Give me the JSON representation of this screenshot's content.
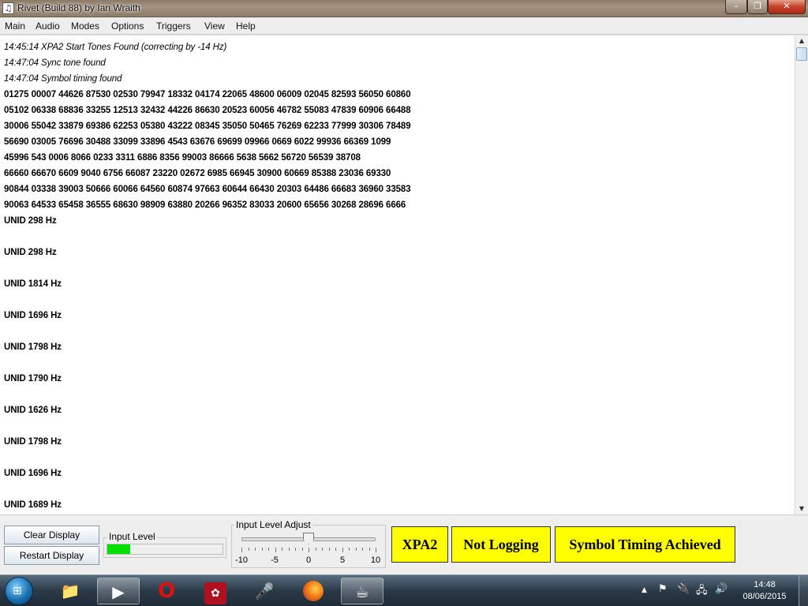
{
  "window": {
    "title": "Rivet (Build 88) by Ian Wraith",
    "min": "–",
    "max": "❐",
    "close": "✕"
  },
  "menu": [
    "Main",
    "Audio",
    "Modes",
    "Options",
    "Triggers",
    "View",
    "Help"
  ],
  "log": [
    "14:45:14 XPA2 Start Tones Found (correcting by -14 Hz)",
    "14:47:04 Sync tone found",
    "14:47:04 Symbol timing found",
    "01275 00007 44626 87530 02530 79947 18332 04174 22065 48600 06009 02045 82593 56050 60860",
    "05102 06338 68836 33255 12513 32432 44226 86630 20523 60056 46782 55083 47839 60906 66488",
    "30006 55042 33879 69386 62253 05380 43222 08345 35050 50465 76269 62233 77999 30306 78489",
    "56690 03005 76696 30488 33099 33896 4543 63676 69699 09966 0669 6022 99936 66369 1099",
    "45996 543 0006 8066 0233 3311 6886 8356 99003 86666 5638 5662 56720 56539 38708",
    "66660 66670 6609 9040 6756 66087 23220 02672 6985 66945 30900 60669 85388 23036 69330",
    "90844 03338 39003 50666 60066 64560 60874 97663 60644 66430 20303 64486 66683 36960 33583",
    "90063 64533 65458 36555 68630 98909 63880 20266 96352 83033 20600 65656 30268 28696 6666",
    "UNID 298 Hz",
    "UNID 298 Hz",
    "UNID 1814 Hz",
    "UNID 1696 Hz",
    "UNID 1798 Hz",
    "UNID 1790 Hz",
    "UNID 1626 Hz",
    "UNID 1798 Hz",
    "UNID 1696 Hz",
    "UNID 1689 Hz"
  ],
  "controls": {
    "clear_label": "Clear Display",
    "restart_label": "Restart Display",
    "input_level_title": "Input Level",
    "input_level_fraction": 0.2,
    "adjust_title": "Input Level Adjust",
    "slider_value": 0,
    "slider_min": -10,
    "slider_max": 10,
    "slider_labels": [
      "-10",
      "-5",
      "0",
      "5",
      "10"
    ]
  },
  "status": {
    "mode": "XPA2",
    "logging": "Not Logging",
    "timing": "Symbol Timing Achieved",
    "color": "#ffff00"
  },
  "taskbar": {
    "icons": [
      "start-orb-icon",
      "folder-icon",
      "media-player-icon",
      "opera-icon",
      "mendeley-icon",
      "microphone-icon",
      "firefox-icon",
      "java-icon"
    ],
    "time": "14:48",
    "date": "08/06/2015"
  }
}
